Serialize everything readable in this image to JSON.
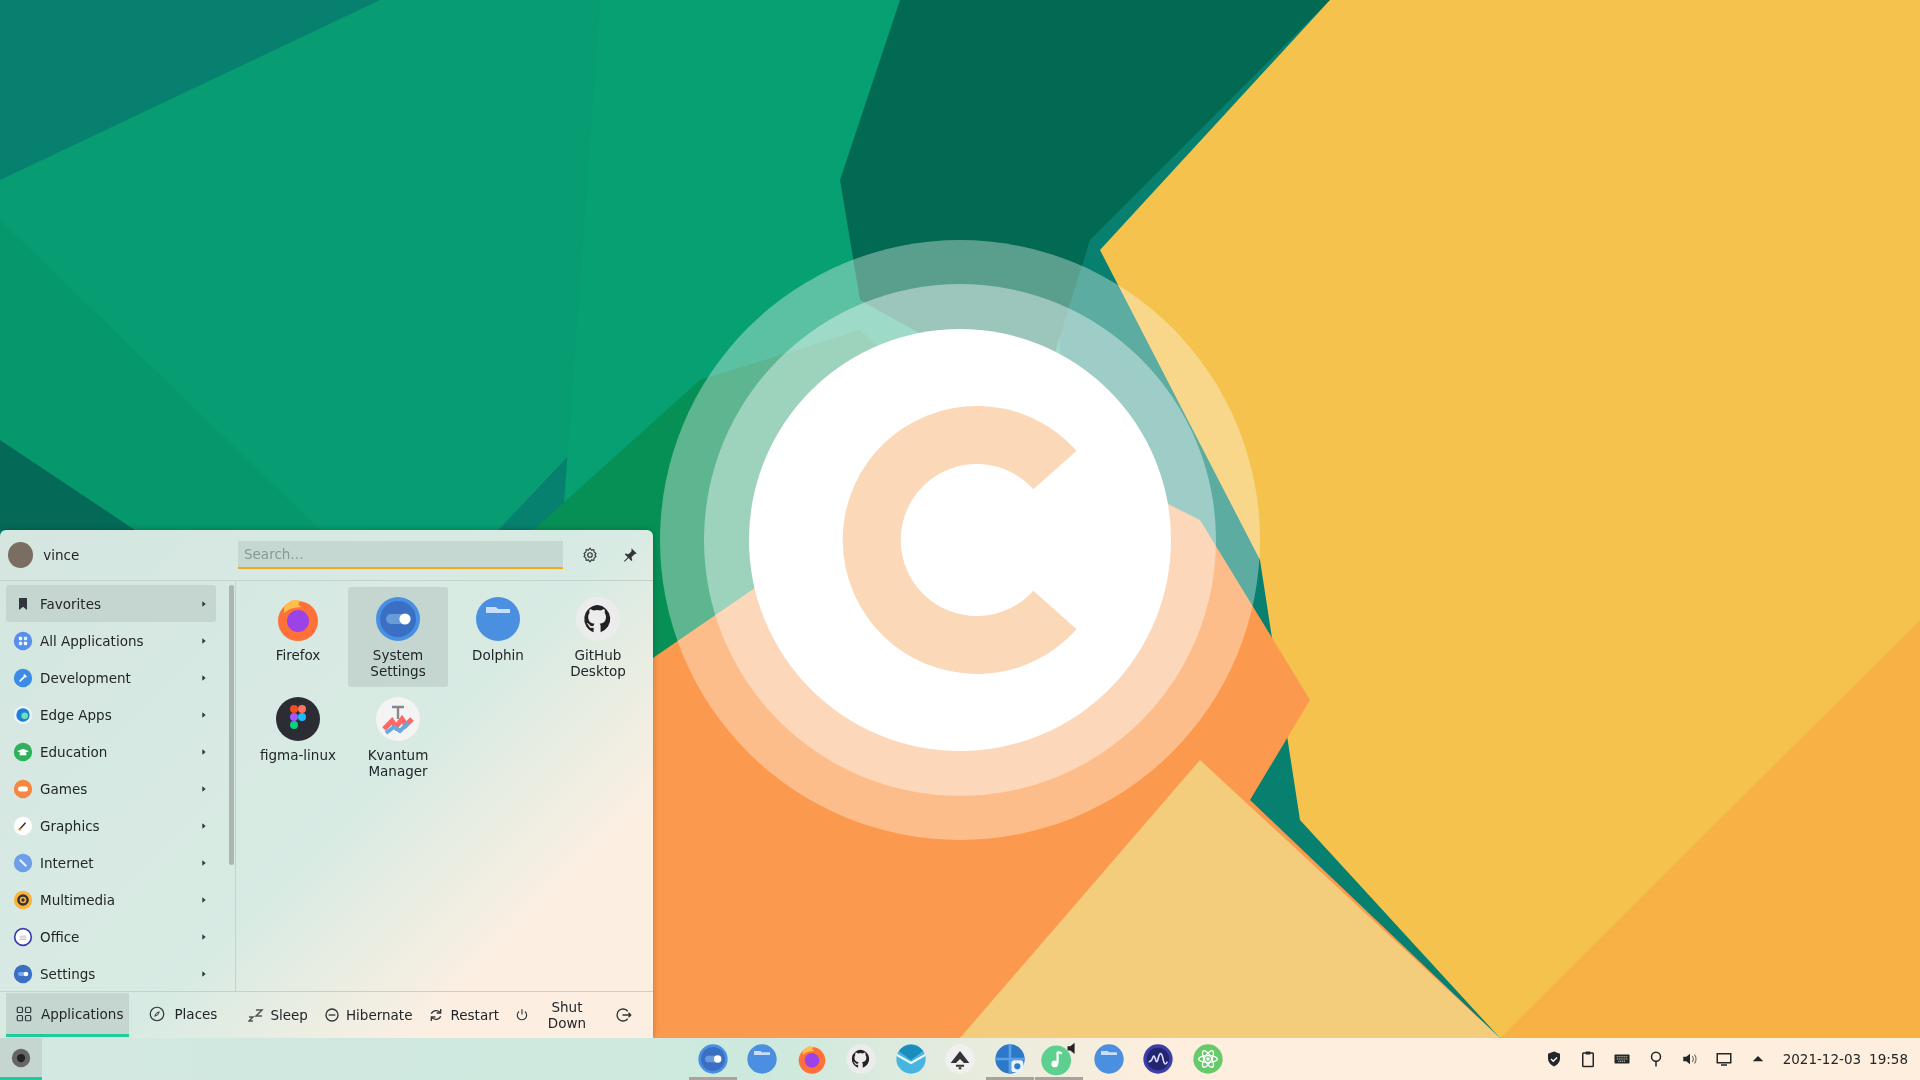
{
  "menu": {
    "user": {
      "name": "vince"
    },
    "search": {
      "placeholder": "Search…"
    },
    "categories": [
      {
        "label": "Favorites",
        "selected": true
      },
      {
        "label": "All Applications",
        "selected": false
      },
      {
        "label": "Development",
        "selected": false
      },
      {
        "label": "Edge Apps",
        "selected": false
      },
      {
        "label": "Education",
        "selected": false
      },
      {
        "label": "Games",
        "selected": false
      },
      {
        "label": "Graphics",
        "selected": false
      },
      {
        "label": "Internet",
        "selected": false
      },
      {
        "label": "Multimedia",
        "selected": false
      },
      {
        "label": "Office",
        "selected": false
      },
      {
        "label": "Settings",
        "selected": false
      }
    ],
    "apps": [
      {
        "name": "Firefox",
        "selected": false
      },
      {
        "name": "System Settings",
        "selected": true
      },
      {
        "name": "Dolphin",
        "selected": false
      },
      {
        "name": "GitHub Desktop",
        "selected": false
      },
      {
        "name": "figma-linux",
        "selected": false
      },
      {
        "name": "Kvantum Manager",
        "selected": false
      }
    ],
    "tabs": [
      {
        "label": "Applications",
        "selected": true
      },
      {
        "label": "Places",
        "selected": false
      }
    ],
    "power": [
      {
        "label": "Sleep",
        "kind": "sleep"
      },
      {
        "label": "Hibernate",
        "kind": "hibernate"
      },
      {
        "label": "Restart",
        "kind": "restart"
      },
      {
        "label": "Shut Down",
        "kind": "shutdown"
      }
    ]
  },
  "taskbar": {
    "tasks": [
      {
        "running": true
      },
      {
        "running": false
      },
      {
        "running": false
      },
      {
        "running": false
      },
      {
        "running": false
      },
      {
        "running": false
      },
      {
        "running": true
      },
      {
        "running": true
      },
      {
        "running": false
      },
      {
        "running": false
      },
      {
        "running": false
      }
    ],
    "clock": {
      "date": "2021-12-03",
      "time": "19:58"
    }
  }
}
